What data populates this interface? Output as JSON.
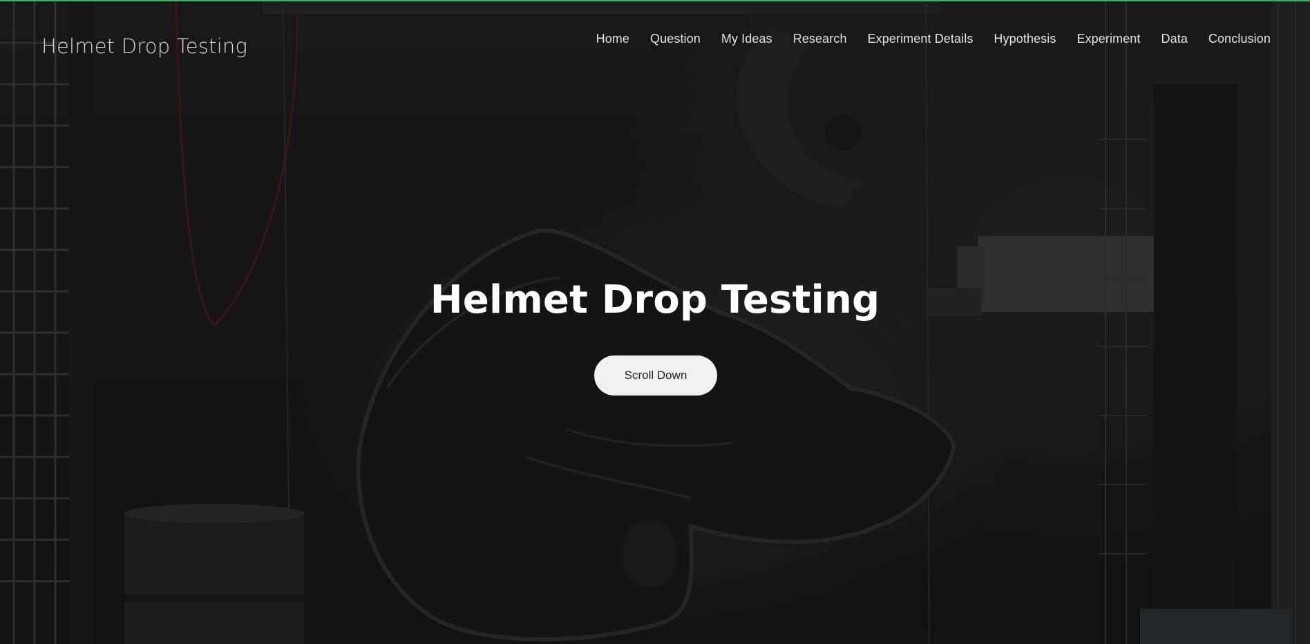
{
  "site": {
    "brand": "Helmet Drop Testing"
  },
  "nav": {
    "items": [
      {
        "label": "Home"
      },
      {
        "label": "Question"
      },
      {
        "label": "My Ideas"
      },
      {
        "label": "Research"
      },
      {
        "label": "Experiment Details"
      },
      {
        "label": "Hypothesis"
      },
      {
        "label": "Experiment"
      },
      {
        "label": "Data"
      },
      {
        "label": "Conclusion"
      }
    ]
  },
  "hero": {
    "title": "Helmet Drop Testing",
    "button_label": "Scroll Down"
  },
  "colors": {
    "top_border": "#3fae6a",
    "button_bg": "#f0f0f0",
    "text": "#ffffff"
  }
}
